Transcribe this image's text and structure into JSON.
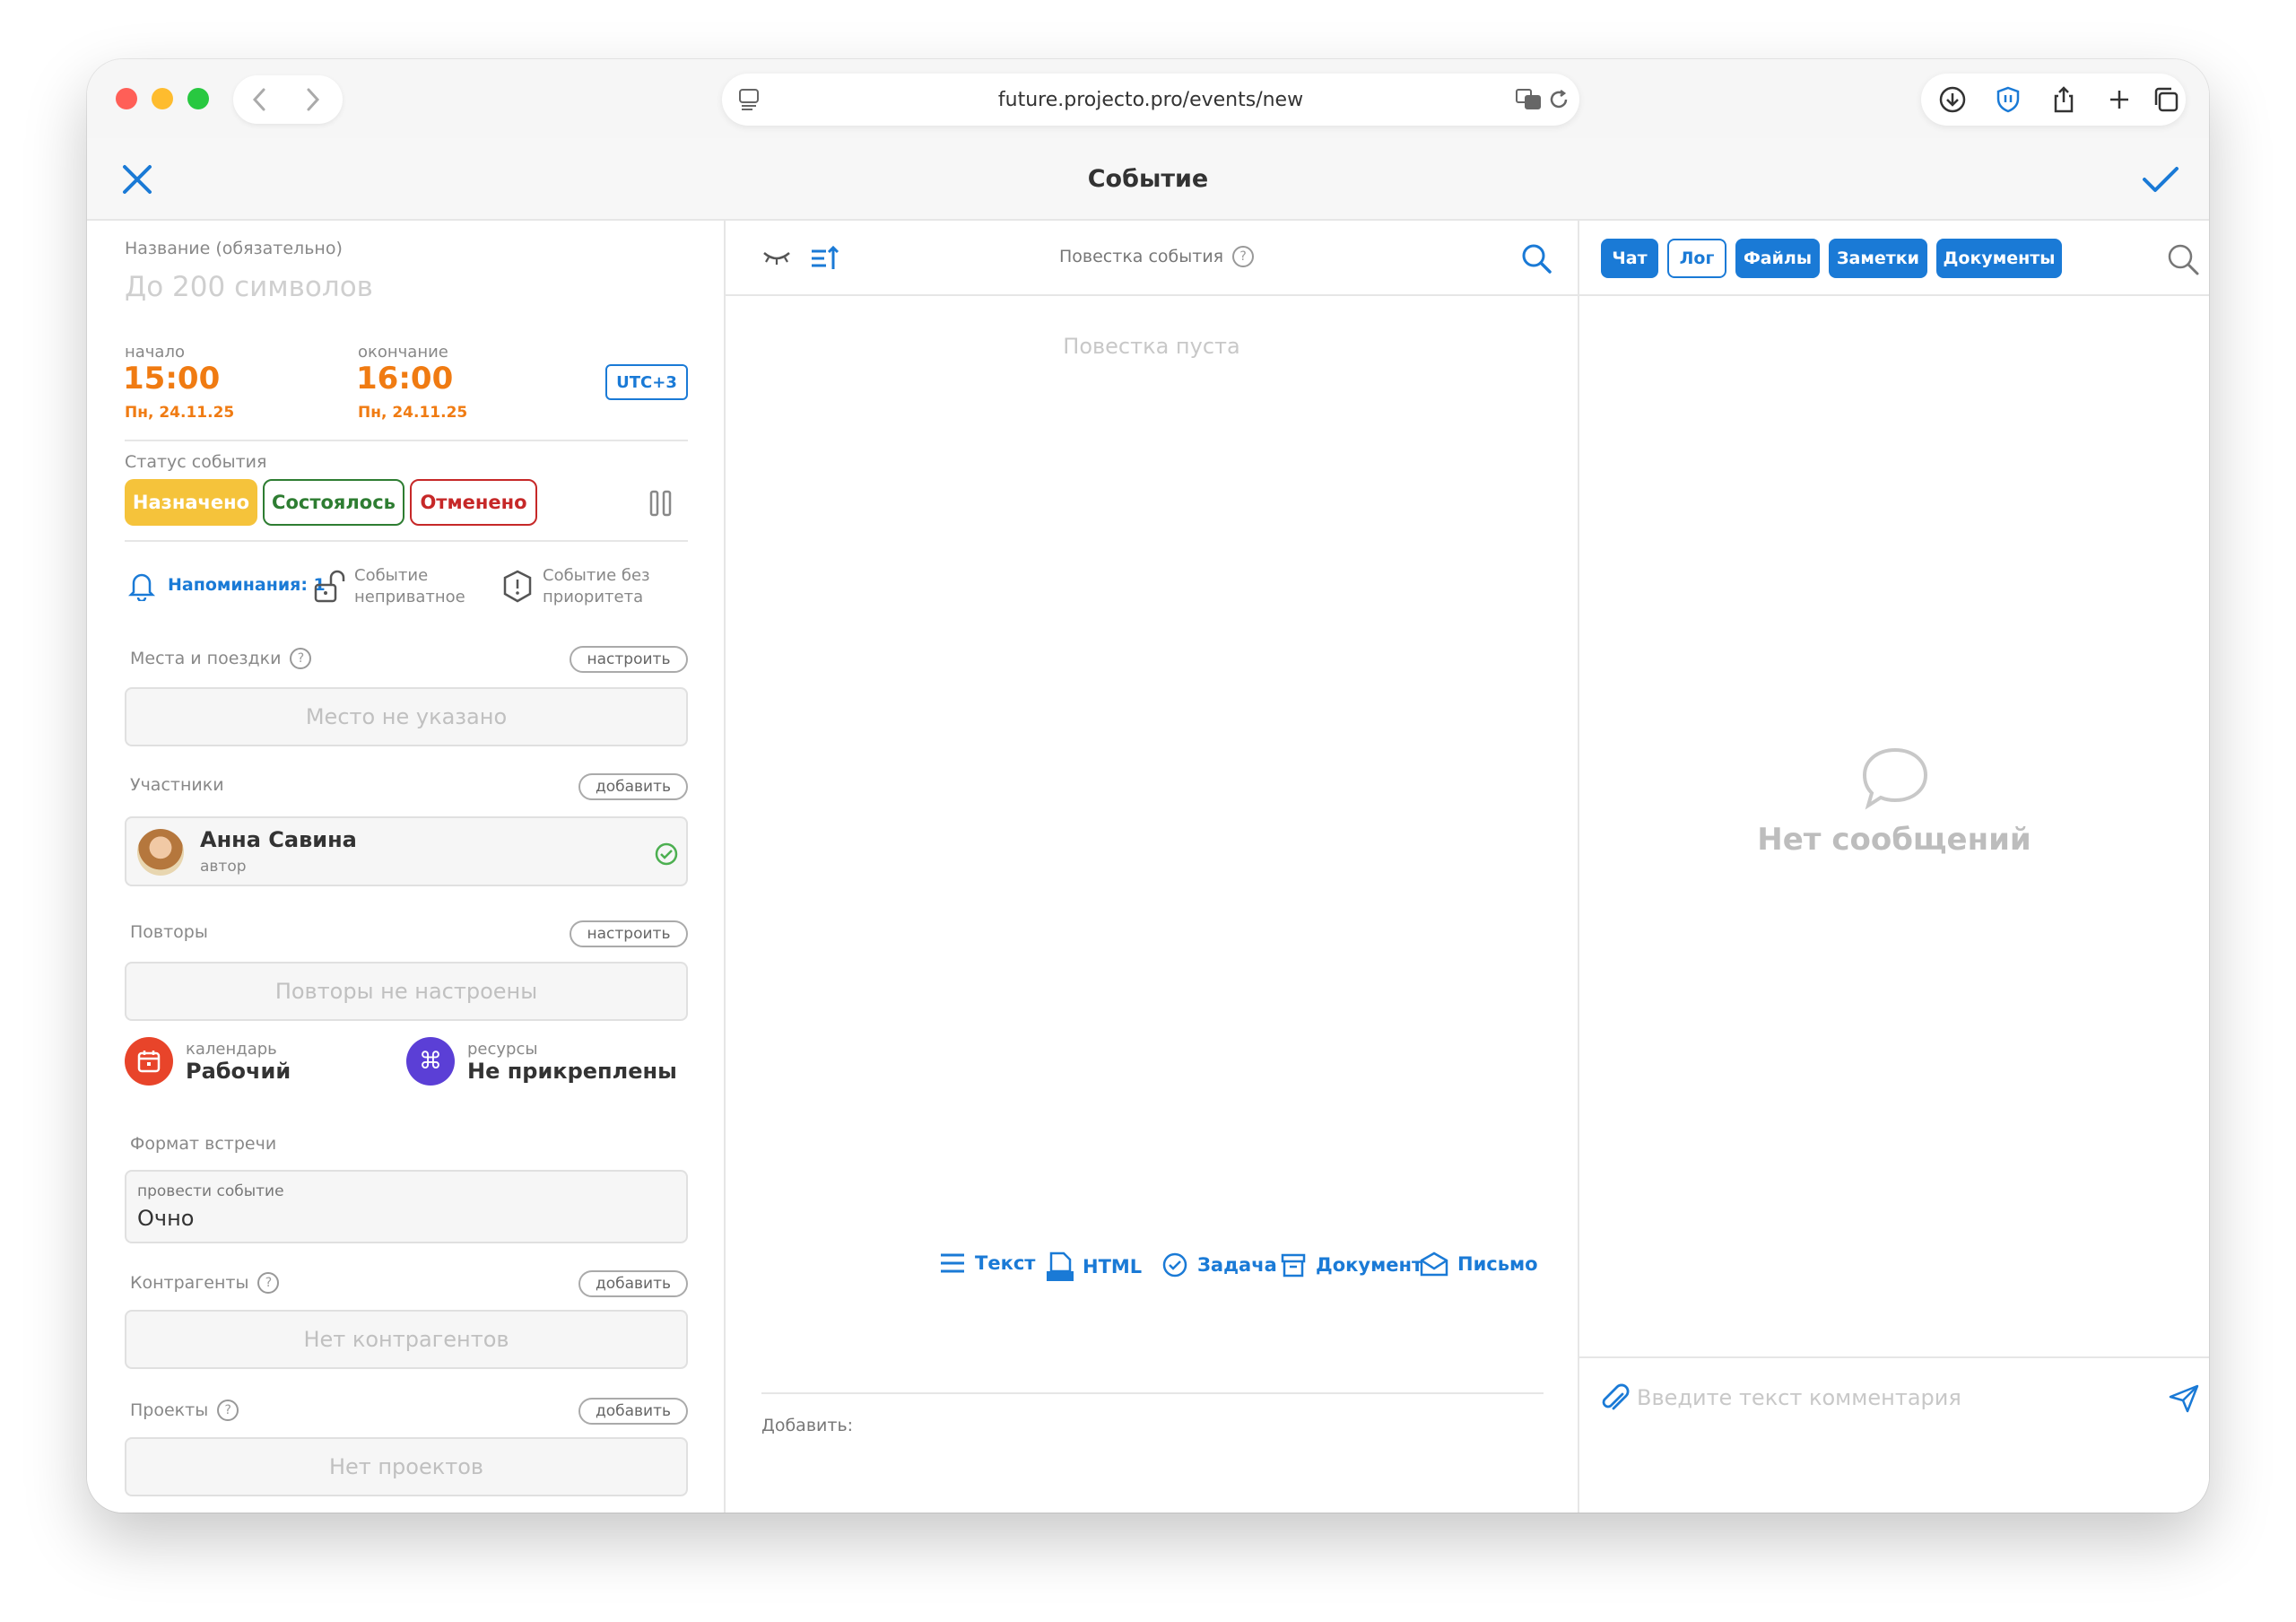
{
  "browser": {
    "url": "future.projecto.pro/events/new"
  },
  "header": {
    "title": "Событие"
  },
  "left": {
    "name_label": "Название (обязательно)",
    "name_placeholder": "До 200 символов",
    "start_label": "начало",
    "start_time": "15:00",
    "start_date": "Пн, 24.11.25",
    "end_label": "окончание",
    "end_time": "16:00",
    "end_date": "Пн, 24.11.25",
    "timezone": "UTC+3",
    "status_label": "Статус события",
    "status_options": [
      "Назначено",
      "Состоялось",
      "Отменено"
    ],
    "reminders": "Напоминания: 1",
    "privacy_line1": "Событие",
    "privacy_line2": "неприватное",
    "priority_line1": "Событие без",
    "priority_line2": "приоритета",
    "places_label": "Места и поездки",
    "places_button": "настроить",
    "places_empty": "Место не указано",
    "participants_label": "Участники",
    "participants_button": "добавить",
    "participant_name": "Анна Савина",
    "participant_role": "автор",
    "repeats_label": "Повторы",
    "repeats_button": "настроить",
    "repeats_empty": "Повторы не настроены",
    "calendar_label": "календарь",
    "calendar_value": "Рабочий",
    "resources_label": "ресурсы",
    "resources_value": "Не прикреплены",
    "format_label": "Формат встречи",
    "format_field_label": "провести событие",
    "format_value": "Очно",
    "contractors_label": "Контрагенты",
    "contractors_button": "добавить",
    "contractors_empty": "Нет контрагентов",
    "projects_label": "Проекты",
    "projects_button": "добавить",
    "projects_empty": "Нет проектов"
  },
  "middle": {
    "agenda_title": "Повестка события",
    "agenda_empty": "Повестка пуста",
    "add_label": "Добавить:",
    "add_items": [
      "Текст",
      "HTML",
      "Задача",
      "Документ",
      "Письмо"
    ]
  },
  "right": {
    "tabs": [
      "Чат",
      "Лог",
      "Файлы",
      "Заметки",
      "Документы"
    ],
    "empty_messages": "Нет сообщений",
    "comment_placeholder": "Введите текст комментария"
  },
  "colors": {
    "accent": "#1a7ad6",
    "orange": "#f07b12",
    "scheduled": "#f5c33b",
    "done": "#2e7d32",
    "cancelled": "#c62828"
  }
}
